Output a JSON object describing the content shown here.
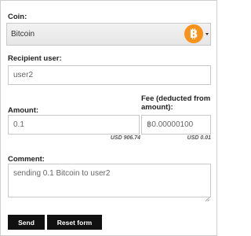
{
  "form": {
    "coin": {
      "label": "Coin:",
      "selected": "Bitcoin",
      "icon": "bitcoin-icon",
      "icon_color": "#f7931a"
    },
    "recipient": {
      "label": "Recipient user:",
      "value": "user2"
    },
    "amount": {
      "label": "Amount:",
      "value": "0.1",
      "usd": "USD 906.74"
    },
    "fee": {
      "label": "Fee (deducted from amount):",
      "value": "฿0.00000100",
      "usd": "USD 0.01"
    },
    "comment": {
      "label": "Comment:",
      "value": "sending 0.1 Bitcoin to user2"
    },
    "buttons": {
      "send": "Send",
      "reset": "Reset form"
    }
  }
}
